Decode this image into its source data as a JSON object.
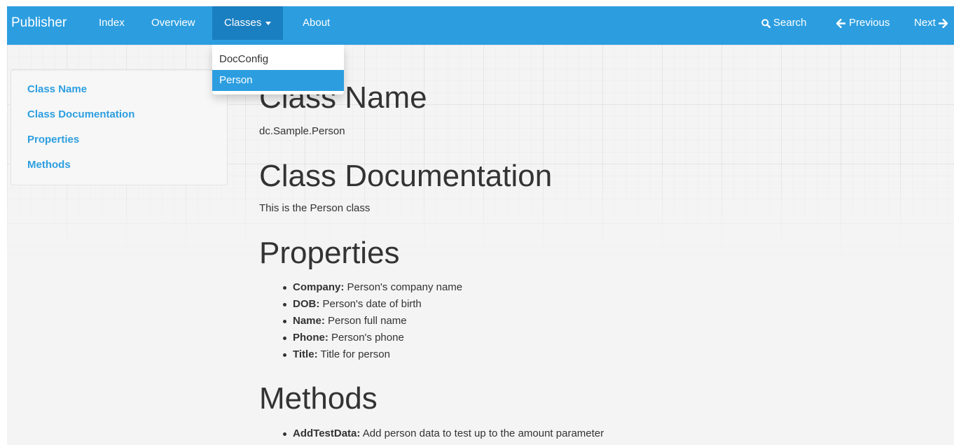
{
  "navbar": {
    "brand": "Publisher",
    "links": [
      {
        "label": "Index"
      },
      {
        "label": "Overview"
      },
      {
        "label": "Classes"
      },
      {
        "label": "About"
      }
    ],
    "right": {
      "search": "Search",
      "previous": "Previous",
      "next": "Next"
    },
    "color": "#2c9ee0",
    "active_color": "#1a7fc1"
  },
  "dropdown": {
    "items": [
      {
        "label": "DocConfig"
      },
      {
        "label": "Person"
      }
    ],
    "selected": "Person"
  },
  "sidebar": {
    "items": [
      {
        "label": "Class Name"
      },
      {
        "label": "Class Documentation"
      },
      {
        "label": "Properties"
      },
      {
        "label": "Methods"
      }
    ]
  },
  "content": {
    "class_name": {
      "heading": "Class Name",
      "value": "dc.Sample.Person"
    },
    "class_doc": {
      "heading": "Class Documentation",
      "value": "This is the Person class"
    },
    "properties": {
      "heading": "Properties",
      "items": [
        {
          "name": "Company:",
          "desc": "Person's company name"
        },
        {
          "name": "DOB:",
          "desc": "Person's date of birth"
        },
        {
          "name": "Name:",
          "desc": "Person full name"
        },
        {
          "name": "Phone:",
          "desc": "Person's phone"
        },
        {
          "name": "Title:",
          "desc": "Title for person"
        }
      ]
    },
    "methods": {
      "heading": "Methods",
      "items": [
        {
          "name": "AddTestData:",
          "desc": "Add person data to test up to the amount parameter"
        }
      ]
    }
  },
  "icons": {
    "search": "search-icon",
    "previous": "arrow-left-icon",
    "next": "arrow-right-icon",
    "caret": "caret-down-icon"
  }
}
